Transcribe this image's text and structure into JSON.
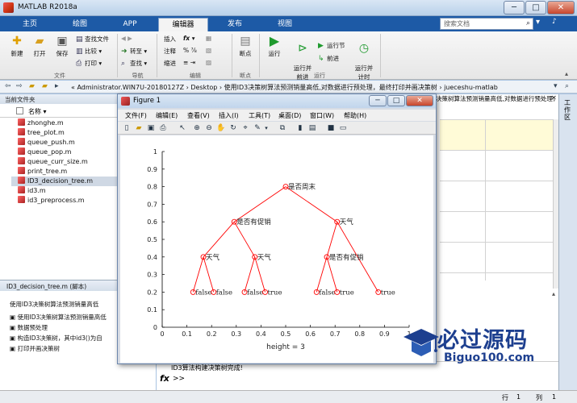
{
  "window": {
    "title": "MATLAB R2018a"
  },
  "tabs": [
    {
      "label": "主页"
    },
    {
      "label": "绘图"
    },
    {
      "label": "APP"
    },
    {
      "label": "编辑器"
    },
    {
      "label": "发布"
    },
    {
      "label": "视图"
    }
  ],
  "search": {
    "placeholder": "搜索文档"
  },
  "ribbon": {
    "file": {
      "new": "新建",
      "open": "打开",
      "save": "保存",
      "find_files": "查找文件",
      "compare": "比较",
      "print": "打印",
      "group": "文件"
    },
    "navigate": {
      "goto": "转至",
      "find": "查找",
      "group": "导航"
    },
    "edit": {
      "insert": "插入",
      "comment": "注释",
      "indent": "缩进",
      "group": "编辑"
    },
    "breakpoints": {
      "label": "断点",
      "group": "断点"
    },
    "run": {
      "run": "运行",
      "run_advance": "运行并\n前进",
      "run_section": "运行节",
      "advance": "前进",
      "run_time": "运行并\n计时",
      "group": "运行"
    }
  },
  "address": {
    "path": "« Administrator.WIN7U-20180127Z  ›  Desktop  ›  使用ID3决策树算法预测销量高低,对数据进行预处理，最终打印并画决策树  ›  jueceshu-matlab"
  },
  "left_panel": {
    "title": "当前文件夹",
    "column_name": "名称 ▾",
    "files": [
      {
        "name": "zhonghe.m"
      },
      {
        "name": "tree_plot.m"
      },
      {
        "name": "queue_push.m"
      },
      {
        "name": "queue_pop.m"
      },
      {
        "name": "queue_curr_size.m"
      },
      {
        "name": "print_tree.m"
      },
      {
        "name": "ID3_decision_tree.m"
      },
      {
        "name": "id3.m"
      },
      {
        "name": "id3_preprocess.m"
      }
    ],
    "detail_title": "ID3_decision_tree.m  (脚本)",
    "detail_desc": "使用ID3决策树算法预测销量高低",
    "outline": [
      {
        "text": "使用ID3决策树算法预测销量高低"
      },
      {
        "text": "数据预处理"
      },
      {
        "text": "构造ID3决策树，其中id3()为自"
      },
      {
        "text": "打印并画决策树"
      }
    ]
  },
  "editor_banner": "决策树算法预测销量高低,对数据进行预处理，",
  "command": {
    "output_line": "ID3算法构建决策树完成!",
    "prompt": ">>",
    "fx": "fx"
  },
  "status": {
    "line_label": "行",
    "line_value": "1",
    "col_label": "列",
    "col_value": "1"
  },
  "right_strip": {
    "label": "工作区"
  },
  "figure": {
    "title": "Figure 1",
    "menu": [
      "文件(F)",
      "编辑(E)",
      "查看(V)",
      "插入(I)",
      "工具(T)",
      "桌面(D)",
      "窗口(W)",
      "帮助(H)"
    ],
    "xlabel": "height = 3"
  },
  "chart_data": {
    "type": "scatter",
    "title": "",
    "xlabel": "height = 3",
    "ylabel": "",
    "xlim": [
      0,
      1
    ],
    "ylim": [
      0,
      1
    ],
    "xticks": [
      "0",
      "0.1",
      "0.2",
      "0.3",
      "0.4",
      "0.5",
      "0.6",
      "0.7",
      "0.8",
      "0.9",
      "1"
    ],
    "yticks": [
      "0",
      "0.1",
      "0.2",
      "0.3",
      "0.4",
      "0.5",
      "0.6",
      "0.7",
      "0.8",
      "0.9",
      "1"
    ],
    "marker_color": "#ff0000",
    "line_color": "#ff0000",
    "nodes": [
      {
        "x": 0.5,
        "y": 0.8,
        "label": "是否周末"
      },
      {
        "x": 0.2917,
        "y": 0.6,
        "label": "是否有促销"
      },
      {
        "x": 0.7083,
        "y": 0.6,
        "label": "天气"
      },
      {
        "x": 0.1667,
        "y": 0.4,
        "label": "天气"
      },
      {
        "x": 0.375,
        "y": 0.4,
        "label": "天气"
      },
      {
        "x": 0.6667,
        "y": 0.4,
        "label": "是否有促销"
      },
      {
        "x": 0.125,
        "y": 0.2,
        "label": "false"
      },
      {
        "x": 0.2083,
        "y": 0.2,
        "label": "false"
      },
      {
        "x": 0.3333,
        "y": 0.2,
        "label": "false"
      },
      {
        "x": 0.4167,
        "y": 0.2,
        "label": "true"
      },
      {
        "x": 0.625,
        "y": 0.2,
        "label": "false"
      },
      {
        "x": 0.7083,
        "y": 0.2,
        "label": "true"
      },
      {
        "x": 0.875,
        "y": 0.2,
        "label": "true"
      }
    ],
    "edges": [
      [
        0,
        1
      ],
      [
        0,
        2
      ],
      [
        1,
        3
      ],
      [
        1,
        4
      ],
      [
        2,
        5
      ],
      [
        2,
        12
      ],
      [
        3,
        6
      ],
      [
        3,
        7
      ],
      [
        4,
        8
      ],
      [
        4,
        9
      ],
      [
        5,
        10
      ],
      [
        5,
        11
      ]
    ]
  },
  "watermark": {
    "text": "必过源码",
    "url": "Biguo100.com"
  }
}
